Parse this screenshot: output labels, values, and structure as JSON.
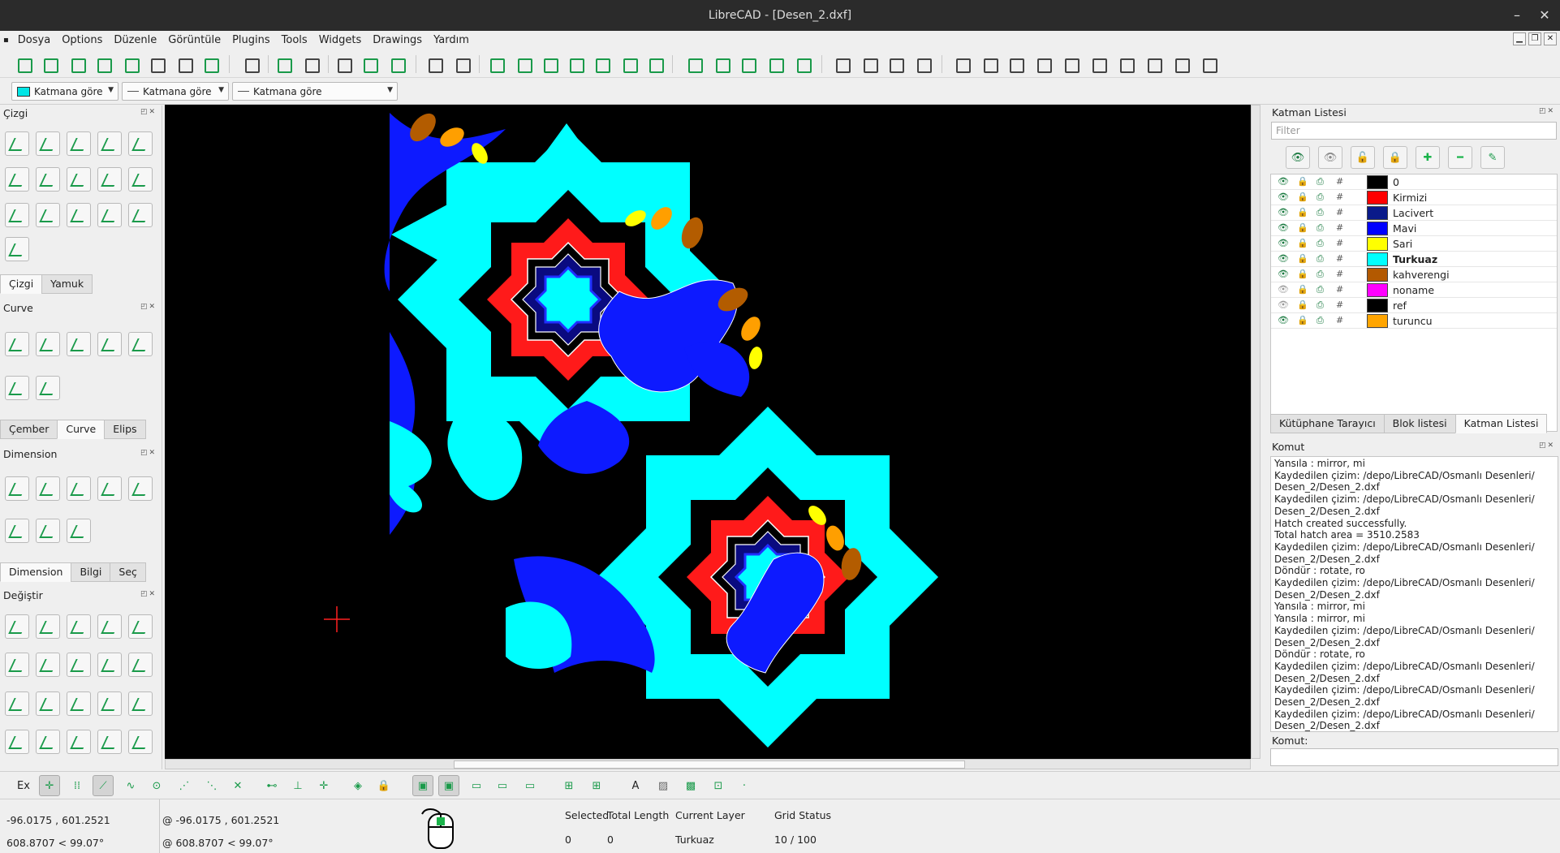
{
  "window": {
    "title": "LibreCAD - [Desen_2.dxf]",
    "min": "–",
    "restore": "❐",
    "close": "✕"
  },
  "menu": [
    "Dosya",
    "Options",
    "Düzenle",
    "Görüntüle",
    "Plugins",
    "Tools",
    "Widgets",
    "Drawings",
    "Yardım"
  ],
  "penbar": {
    "color": "Katmana göre",
    "width": "Katmana göre",
    "type": "Katmana göre"
  },
  "left": {
    "cizgi": {
      "title": "Çizgi",
      "tabs": [
        "Çizgi",
        "Yamuk"
      ]
    },
    "curve": {
      "title": "Curve",
      "tabs": [
        "Çember",
        "Curve",
        "Elips"
      ]
    },
    "dimension": {
      "title": "Dimension",
      "tabs": [
        "Dimension",
        "Bilgi",
        "Seç"
      ]
    },
    "degistir": {
      "title": "Değiştir"
    }
  },
  "layers": {
    "title": "Katman Listesi",
    "filter_placeholder": "Filter",
    "rows": [
      {
        "name": "0",
        "color": "#000000",
        "bold": false,
        "visible": true
      },
      {
        "name": "Kirmizi",
        "color": "#ff0000",
        "bold": false,
        "visible": true
      },
      {
        "name": "Lacivert",
        "color": "#0a1a8a",
        "bold": false,
        "visible": true
      },
      {
        "name": "Mavi",
        "color": "#0000ff",
        "bold": false,
        "visible": true
      },
      {
        "name": "Sari",
        "color": "#ffff00",
        "bold": false,
        "visible": true
      },
      {
        "name": "Turkuaz",
        "color": "#00ffff",
        "bold": true,
        "visible": true
      },
      {
        "name": "kahverengi",
        "color": "#b35900",
        "bold": false,
        "visible": true
      },
      {
        "name": "noname",
        "color": "#ff00ff",
        "bold": false,
        "visible": false
      },
      {
        "name": "ref",
        "color": "#000000",
        "bold": false,
        "visible": false
      },
      {
        "name": "turuncu",
        "color": "#ffa500",
        "bold": false,
        "visible": true
      }
    ],
    "tabs": [
      "Kütüphane Tarayıcı",
      "Blok listesi",
      "Katman Listesi"
    ]
  },
  "command": {
    "title": "Komut",
    "input_label": "Komut:",
    "lines": [
      "Yansıla : mirror, mi",
      "Kaydedilen çizim: /depo/LibreCAD/Osmanlı Desenleri/",
      "Desen_2/Desen_2.dxf",
      "Kaydedilen çizim: /depo/LibreCAD/Osmanlı Desenleri/",
      "Desen_2/Desen_2.dxf",
      "Hatch created successfully.",
      "Total hatch area =  3510.2583",
      "Kaydedilen çizim: /depo/LibreCAD/Osmanlı Desenleri/",
      "Desen_2/Desen_2.dxf",
      "Döndür : rotate, ro",
      "Kaydedilen çizim: /depo/LibreCAD/Osmanlı Desenleri/",
      "Desen_2/Desen_2.dxf",
      "Yansıla : mirror, mi",
      "Yansıla : mirror, mi",
      "Kaydedilen çizim: /depo/LibreCAD/Osmanlı Desenleri/",
      "Desen_2/Desen_2.dxf",
      "Döndür : rotate, ro",
      "Kaydedilen çizim: /depo/LibreCAD/Osmanlı Desenleri/",
      "Desen_2/Desen_2.dxf",
      "Kaydedilen çizim: /depo/LibreCAD/Osmanlı Desenleri/",
      "Desen_2/Desen_2.dxf",
      "Kaydedilen çizim: /depo/LibreCAD/Osmanlı Desenleri/",
      "Desen_2/Desen_2.dxf"
    ]
  },
  "snap": {
    "ex": "Ex"
  },
  "status": {
    "abs": "-96.0175 , 601.2521",
    "polar": "608.8707 < 99.07°",
    "rel_abs": "@  -96.0175 , 601.2521",
    "rel_polar": "@  608.8707 < 99.07°",
    "selected_label": "Selected",
    "selected": "0",
    "length_label": "Total Length",
    "length": "0",
    "layer_label": "Current Layer",
    "layer": "Turkuaz",
    "grid_label": "Grid Status",
    "grid": "10 / 100"
  },
  "colors": {
    "cyan": "#00ffff",
    "red": "#ff1a1a",
    "blue": "#0d1aff",
    "navy": "#0a0a80",
    "brown": "#b35c00",
    "yellow": "#ffff00",
    "orange": "#ff9f00"
  }
}
